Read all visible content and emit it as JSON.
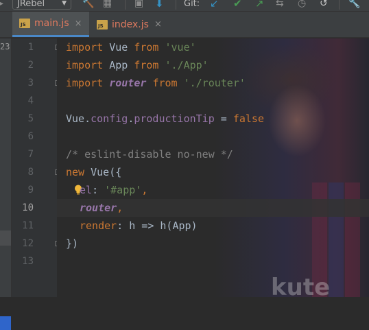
{
  "toolbar": {
    "jrebel_label": "JRebel",
    "git_label": "Git:"
  },
  "tabs": [
    {
      "icon": "JS",
      "label": "main.js",
      "close": "×",
      "active": true
    },
    {
      "icon": "JS",
      "label": "index.js",
      "close": "×",
      "active": false
    }
  ],
  "left_strip": {
    "number": "23"
  },
  "gutter": {
    "line_numbers": [
      "1",
      "2",
      "3",
      "4",
      "5",
      "6",
      "7",
      "8",
      "9",
      "10",
      "11",
      "12",
      "13"
    ],
    "current_line": "10"
  },
  "code": {
    "line1": {
      "kw": "import",
      "name": " Vue ",
      "kw2": "from",
      "sp": " ",
      "str": "'vue'"
    },
    "line2": {
      "kw": "import",
      "name": " App ",
      "kw2": "from",
      "sp": " ",
      "str": "'./App'"
    },
    "line3": {
      "kw": "import",
      "sp1": " ",
      "name": "router",
      "sp2": " ",
      "kw2": "from",
      "sp3": " ",
      "str": "'./router'"
    },
    "line5": {
      "obj": "Vue.",
      "p1": "config",
      "dot": ".",
      "p2": "productionTip",
      "eq": " = ",
      "val": "false"
    },
    "line7": {
      "comment": "/* eslint-disable no-new */"
    },
    "line8": {
      "kw": "new",
      "rest": " Vue({"
    },
    "line9": {
      "key": "el",
      "colon": ": ",
      "str": "'#app'",
      "comma": ","
    },
    "line10": {
      "name": "router",
      "comma": ","
    },
    "line11": {
      "key": "render",
      "rest": ": h => h(App)"
    },
    "line12": {
      "text": "})"
    }
  },
  "background": {
    "overlay_text": "kute"
  },
  "colors": {
    "keyword": "#cc7832",
    "string": "#6a8759",
    "comment": "#808080",
    "property": "#9876aa",
    "text": "#a9b7c6",
    "tab_accent": "#4a88c7"
  }
}
